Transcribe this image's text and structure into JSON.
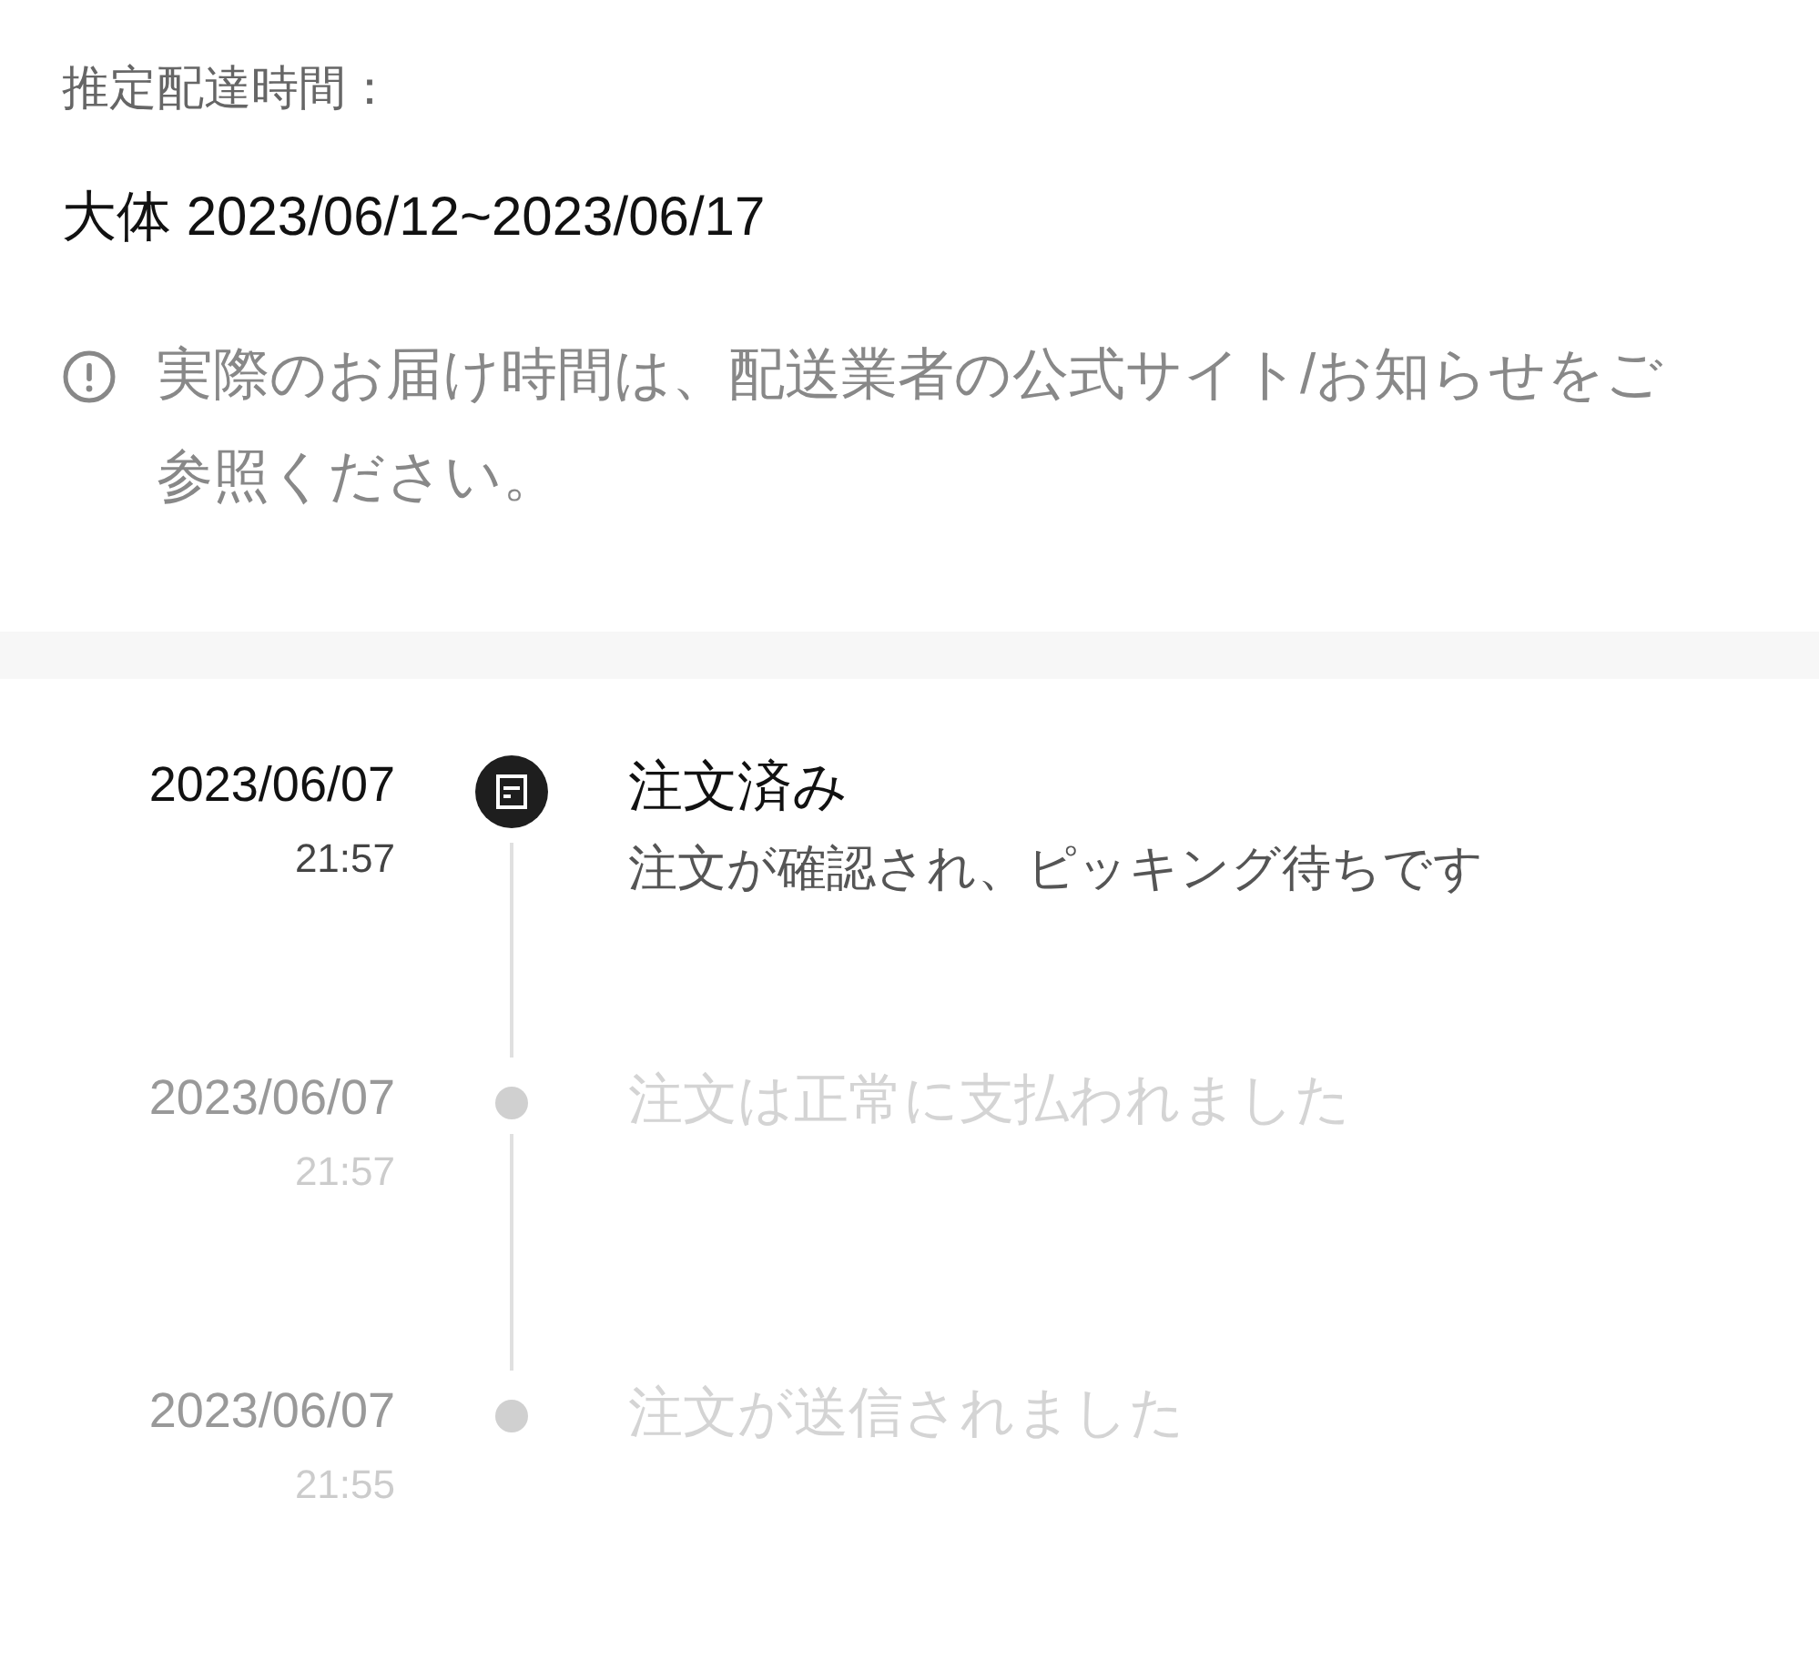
{
  "delivery": {
    "label": "推定配達時間：",
    "range": "大体 2023/06/12~2023/06/17",
    "notice": "実際のお届け時間は、配送業者の公式サイト/お知らせをご参照ください。"
  },
  "timeline": [
    {
      "date": "2023/06/07",
      "time": "21:57",
      "title": "注文済み",
      "description": "注文が確認され、ピッキング待ちです",
      "current": true
    },
    {
      "date": "2023/06/07",
      "time": "21:57",
      "title": "注文は正常に支払われました",
      "current": false
    },
    {
      "date": "2023/06/07",
      "time": "21:55",
      "title": "注文が送信されました",
      "current": false
    }
  ]
}
